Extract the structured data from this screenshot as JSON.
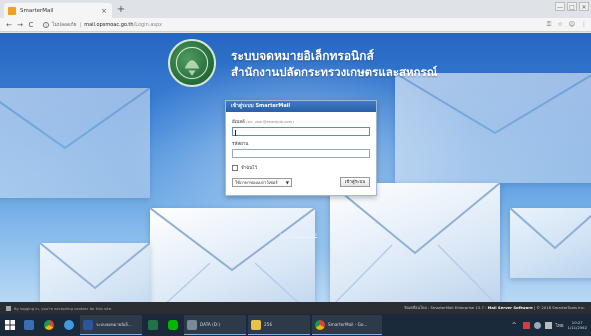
{
  "browser": {
    "tab_title": "SmarterMail",
    "tab_close": "×",
    "new_tab": "+",
    "secure_text": "ไม่ปลอดภัย",
    "url_host": "mail.opsmoac.go.th",
    "url_path": "/Login.aspx",
    "back": "←",
    "forward": "→",
    "reload": "C",
    "window_buttons": [
      "—",
      "□",
      "✕"
    ]
  },
  "header": {
    "title_line1": "ระบบจดหมายอิเล็กทรอนิกส์",
    "title_line2": "สำนักงานปลัดกระทรวงเกษตรและสหกรณ์"
  },
  "login": {
    "panel_title": "เข้าสู่ระบบ SmarterMail",
    "email_label": "อีเมลล์",
    "email_hint": "(ex. user@example.com)",
    "email_value": "",
    "password_label": "รหัสผ่าน",
    "password_value": "",
    "remember_label": "จำฉันไว้",
    "language_value": "ใช้ภาษาของเบราว์เซอร์",
    "language_arrow": "▼",
    "login_button": "เข้าสู่ระบบ"
  },
  "mobile_link": "mobile interface",
  "footer": {
    "left_text": "By logging in, you're accepting cookies for this site.",
    "right_prefix": "ขับเคลื่อนโดย : SmarterMail Enterprise 15.7 : ",
    "right_product": "Mail Server Software",
    "right_suffix": " | © 2018 SmarterTools Inc."
  },
  "taskbar": {
    "word_label": "ระบบจดหมายอิเล็...",
    "data_label": "DATA (D:)",
    "folder_label": "256",
    "chrome_label": "SmarterMail - Go...",
    "tray_lang": "ไทย",
    "clock_time": "10:27",
    "clock_date": "1/11/2562"
  },
  "colors": {
    "panel_header": "#2a5ea8",
    "page_blue": "#3f86d8",
    "taskbar": "#1b2a3a"
  }
}
